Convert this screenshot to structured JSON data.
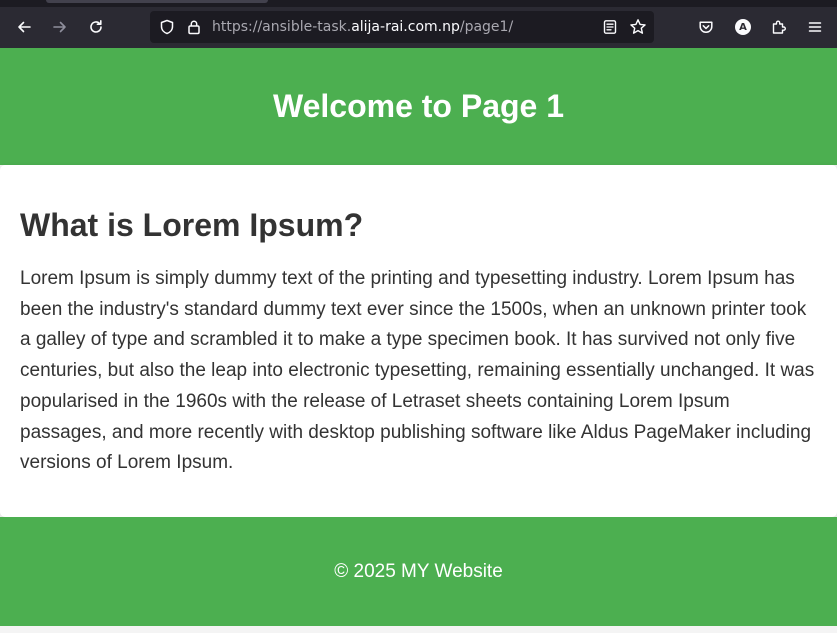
{
  "browser": {
    "url_scheme_prefix": "https://ansible-task.",
    "url_host": "alija-rai.com.np",
    "url_path": "/page1/",
    "account_initial": "A"
  },
  "icons": {
    "back": "arrow-left-icon",
    "forward": "arrow-right-icon",
    "reload": "reload-icon",
    "tracking_protection": "shield-icon",
    "secure": "lock-icon",
    "reader_mode": "reader-view-icon",
    "bookmark": "star-icon",
    "pocket": "pocket-icon",
    "account": "account-avatar-icon",
    "extensions": "puzzle-icon",
    "menu": "hamburger-menu-icon"
  },
  "page": {
    "header_title": "Welcome to Page 1",
    "section_heading": "What is Lorem Ipsum?",
    "section_body": "Lorem Ipsum is simply dummy text of the printing and typesetting industry. Lorem Ipsum has been the industry's standard dummy text ever since the 1500s, when an unknown printer took a galley of type and scrambled it to make a type specimen book. It has survived not only five centuries, but also the leap into electronic typesetting, remaining essentially unchanged. It was popularised in the 1960s with the release of Letraset sheets containing Lorem Ipsum passages, and more recently with desktop publishing software like Aldus PageMaker including versions of Lorem Ipsum.",
    "footer_text": "© 2025 MY Website"
  },
  "colors": {
    "accent_green": "#4caf50",
    "text_dark": "#333333",
    "chrome_bg": "#2b2a33",
    "urlbar_bg": "#1c1b22"
  }
}
